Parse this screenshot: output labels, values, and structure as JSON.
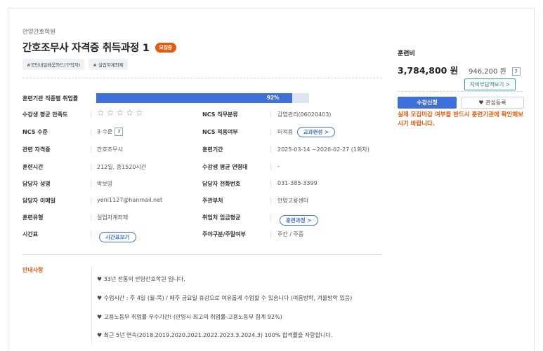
{
  "institution": "안양간호학원",
  "course": {
    "title": "간호조무사 자격증 취득과정 1",
    "status_badge": "모집중",
    "tags": [
      "#국민내일배움카드(구직자)",
      "# 실업자계좌제"
    ]
  },
  "employment": {
    "label": "훈련기관 직종별 취업률",
    "rate_text": "92%",
    "rate": 0.92
  },
  "satisfaction": {
    "label": "수강생 평균 만족도",
    "stars_filled": 0,
    "stars_total": 5
  },
  "fields": {
    "ncs_category": {
      "label": "NCS 직무분류",
      "value": "감염관리(06020403)"
    },
    "ncs_level": {
      "label": "NCS 수준",
      "value": "3 수준",
      "help": "?"
    },
    "ncs_applied": {
      "label": "NCS 적용여부",
      "value": "미적용",
      "button": "교과편성 >"
    },
    "cert": {
      "label": "관련 자격증",
      "value": "간호조무사"
    },
    "period": {
      "label": "훈련기간",
      "value": "2025-03-14 ~2026-02-27 (1회차)"
    },
    "hours": {
      "label": "훈련시간",
      "value": "212일, 총1520시간"
    },
    "age": {
      "label": "수강생 평균 연령대",
      "value": "-"
    },
    "manager": {
      "label": "담당자 성명",
      "value": "박보영"
    },
    "phone": {
      "label": "담당자 전화번호",
      "value": "031-385-3399"
    },
    "email": {
      "label": "담당자 이메일",
      "value": "yeni1127@hanmail.net"
    },
    "ministry": {
      "label": "주관부처",
      "value": "안양고용센터"
    },
    "type": {
      "label": "훈련유형",
      "value": "실업자계좌제"
    },
    "wage": {
      "label": "취업처 임금평균",
      "button": "훈련과정 >"
    },
    "schedule": {
      "label": "시간표",
      "button": "시간표보기"
    },
    "daytime": {
      "label": "주야구분/주말여부",
      "value": "주간 / 주중"
    }
  },
  "notice": {
    "title": "안내사항",
    "lines": [
      "♥ 33년 전통의 안양간호학원 입니다.",
      "♥ 수업시간 : 주 4일 (월-목) / 매주 금요일 휴강으로 여유롭게 수업할 수 있습니다 (여름방학, 겨울방학 있음)",
      "♥ 고용노동부 취업률 우수기관! (안양시 최고의 취업률-고용노동부 집계 92%)",
      "♥ 최근 5년 연속(2018.2019.2020.2021.2022.2023.3.2024.3) 100% 합격률을 자랑합니다."
    ]
  },
  "fee": {
    "label": "훈련비",
    "price": "3,784,800 원",
    "self_pay": "946,200 원",
    "help": "?",
    "self_pay_button": "자비부담액보기 >",
    "apply_button": "수강신청",
    "favorite_button": "관심등록",
    "warning": "실제 모집마감 여부를 반드시 훈련기관에 확인해보시기 바랍니다."
  },
  "colors": {
    "accent": "#3f6fd8",
    "warning": "#e8590c",
    "teal": "#2aa19b"
  }
}
